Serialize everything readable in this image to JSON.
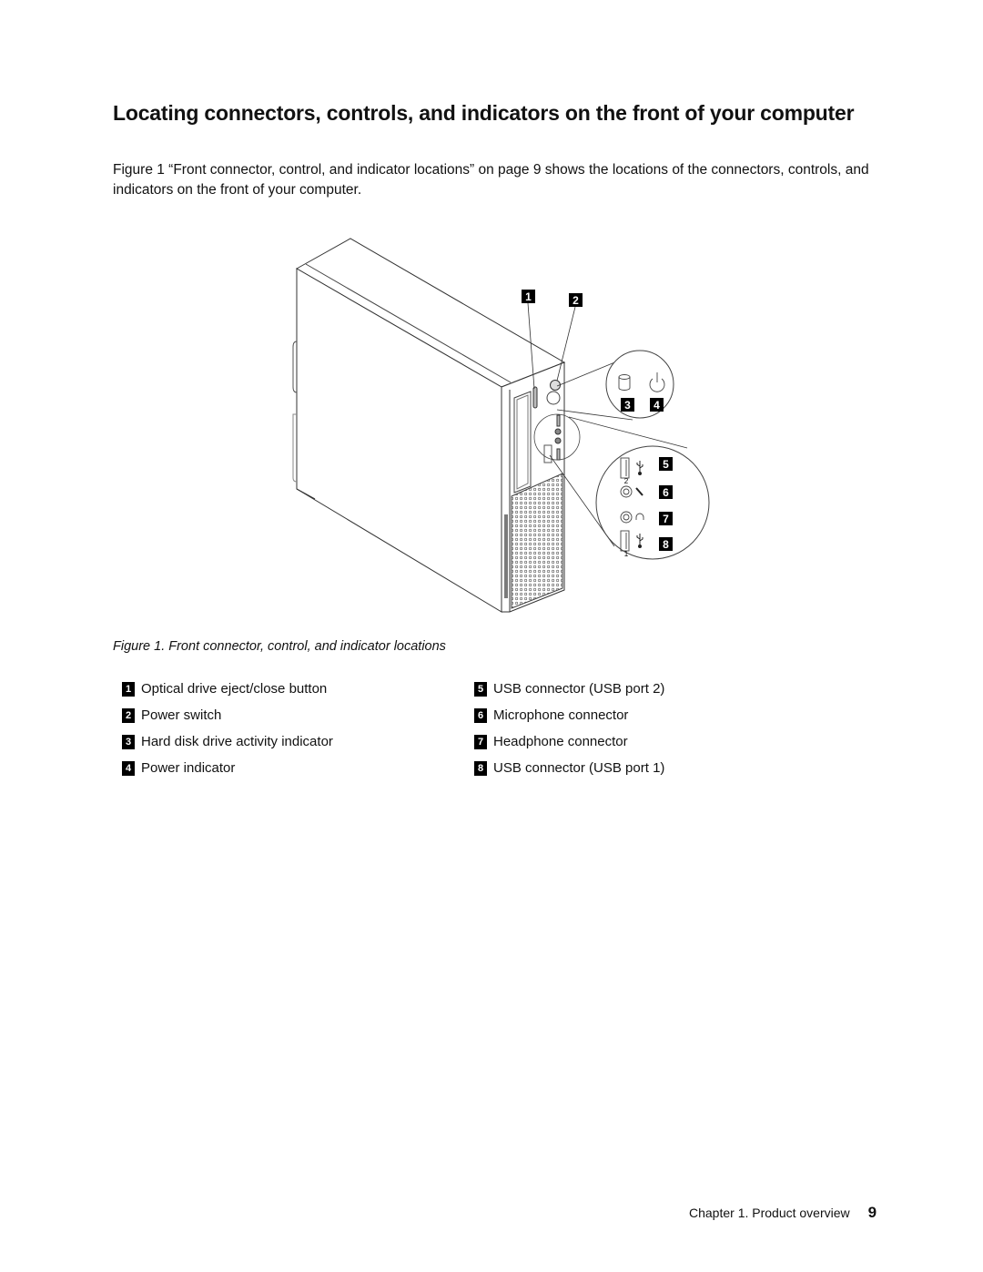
{
  "heading": "Locating connectors, controls, and indicators on the front of your computer",
  "intro": "Figure 1 “Front connector, control, and indicator locations” on page 9 shows the locations of the connectors, controls, and indicators on the front of your computer.",
  "figure": {
    "caption": "Figure 1.  Front connector, control, and indicator locations",
    "callouts": [
      "1",
      "2",
      "3",
      "4",
      "5",
      "6",
      "7",
      "8"
    ],
    "port_labels": [
      "2",
      "1"
    ],
    "icons": [
      "hdd-activity-icon",
      "power-icon",
      "usb-icon",
      "microphone-icon",
      "headphone-icon",
      "usb-icon"
    ]
  },
  "legend": {
    "left": [
      {
        "num": "1",
        "label": "Optical drive eject/close button"
      },
      {
        "num": "2",
        "label": "Power switch"
      },
      {
        "num": "3",
        "label": "Hard disk drive activity indicator"
      },
      {
        "num": "4",
        "label": "Power indicator"
      }
    ],
    "right": [
      {
        "num": "5",
        "label": "USB connector (USB port 2)"
      },
      {
        "num": "6",
        "label": "Microphone connector"
      },
      {
        "num": "7",
        "label": "Headphone connector"
      },
      {
        "num": "8",
        "label": "USB connector (USB port 1)"
      }
    ]
  },
  "footer": {
    "chapter": "Chapter 1.  Product overview",
    "page": "9"
  }
}
